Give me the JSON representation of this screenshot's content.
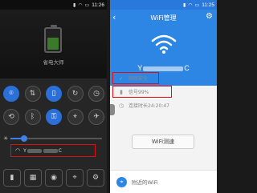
{
  "left": {
    "status": {
      "time": "11:26",
      "icons": [
        "signal",
        "wifi",
        "battery"
      ]
    },
    "battery": {
      "title": "省电大师",
      "subtitle": "",
      "level": 0.55
    },
    "toggles_row1": [
      {
        "name": "wifi-toggle",
        "glyph": "⌾",
        "on": true
      },
      {
        "name": "data-toggle",
        "glyph": "⇅",
        "on": false
      },
      {
        "name": "vibrate-toggle",
        "glyph": "▯",
        "on": true
      },
      {
        "name": "sync-toggle",
        "glyph": "↻",
        "on": false
      },
      {
        "name": "timer-toggle",
        "glyph": "◷",
        "on": false
      }
    ],
    "toggles_row2": [
      {
        "name": "rotate-toggle",
        "glyph": "⟲",
        "on": false
      },
      {
        "name": "bluetooth-toggle",
        "glyph": "ᛒ",
        "on": false
      },
      {
        "name": "lock-toggle",
        "glyph": "⚿",
        "on": true
      },
      {
        "name": "gps-toggle",
        "glyph": "⌖",
        "on": false
      },
      {
        "name": "airplane-toggle",
        "glyph": "✈",
        "on": false
      }
    ],
    "brightness": {
      "auto_label": "",
      "level": 0.15
    },
    "wifi_bar": {
      "ssid_prefix": "Y",
      "ssid_suffix": "C"
    },
    "shortcuts": [
      {
        "name": "flashlight-shortcut",
        "glyph": "▮"
      },
      {
        "name": "calculator-shortcut",
        "glyph": "▦"
      },
      {
        "name": "camera-shortcut",
        "glyph": "◉"
      },
      {
        "name": "location-shortcut",
        "glyph": "⌖"
      },
      {
        "name": "settings-shortcut",
        "glyph": "⚙"
      }
    ]
  },
  "right": {
    "status": {
      "time": "11:25"
    },
    "title": "WiFi管理",
    "ssid_prefix": "Y",
    "ssid_suffix": "C",
    "info": [
      {
        "icon": "✓",
        "icon_name": "shield-check-icon",
        "text": "网络安全",
        "boxed": true,
        "box_w": 58
      },
      {
        "icon": "▮",
        "icon_name": "signal-icon",
        "text": "信号99%",
        "boxed": true,
        "box_w": 74
      },
      {
        "icon": "◷",
        "icon_name": "clock-icon",
        "text": "连接时长24:20:47",
        "boxed": false
      }
    ],
    "speed_button": "WiFi测速",
    "nearby_label": "附近的WiFi"
  },
  "colors": {
    "accent": "#2e86e4",
    "highlight": "#dd1111"
  }
}
